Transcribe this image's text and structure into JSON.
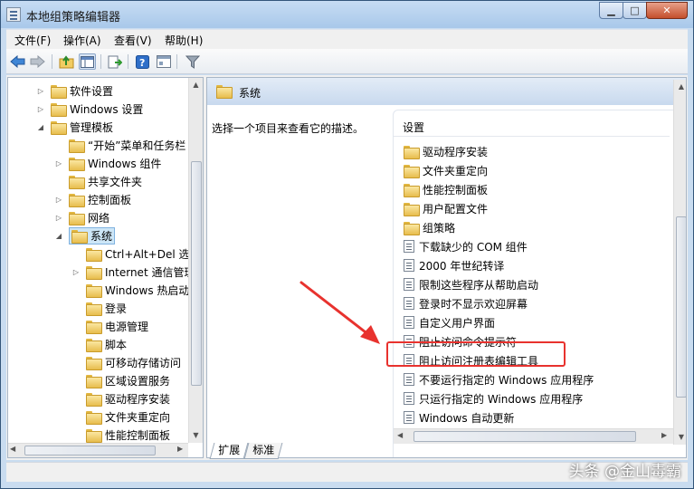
{
  "window": {
    "title": "本地组策略编辑器"
  },
  "menu": [
    "文件(F)",
    "操作(A)",
    "查看(V)",
    "帮助(H)"
  ],
  "tree": [
    {
      "label": "软件设置",
      "level": 1,
      "toggle": "▷",
      "folder": true
    },
    {
      "label": "Windows 设置",
      "level": 1,
      "toggle": "▷",
      "folder": true
    },
    {
      "label": "管理模板",
      "level": 1,
      "toggle": "◢",
      "folder": true
    },
    {
      "label": "“开始”菜单和任务栏",
      "level": 2,
      "toggle": "",
      "folder": true
    },
    {
      "label": "Windows 组件",
      "level": 2,
      "toggle": "▷",
      "folder": true
    },
    {
      "label": "共享文件夹",
      "level": 2,
      "toggle": "",
      "folder": true
    },
    {
      "label": "控制面板",
      "level": 2,
      "toggle": "▷",
      "folder": true
    },
    {
      "label": "网络",
      "level": 2,
      "toggle": "▷",
      "folder": true
    },
    {
      "label": "系统",
      "level": 2,
      "toggle": "◢",
      "folder": true,
      "selected": true
    },
    {
      "label": "Ctrl+Alt+Del 选项",
      "level": 3,
      "toggle": "",
      "folder": true
    },
    {
      "label": "Internet 通信管理",
      "level": 3,
      "toggle": "▷",
      "folder": true
    },
    {
      "label": "Windows 热启动",
      "level": 3,
      "toggle": "",
      "folder": true
    },
    {
      "label": "登录",
      "level": 3,
      "toggle": "",
      "folder": true
    },
    {
      "label": "电源管理",
      "level": 3,
      "toggle": "",
      "folder": true
    },
    {
      "label": "脚本",
      "level": 3,
      "toggle": "",
      "folder": true
    },
    {
      "label": "可移动存储访问",
      "level": 3,
      "toggle": "",
      "folder": true
    },
    {
      "label": "区域设置服务",
      "level": 3,
      "toggle": "",
      "folder": true
    },
    {
      "label": "驱动程序安装",
      "level": 3,
      "toggle": "",
      "folder": true
    },
    {
      "label": "文件夹重定向",
      "level": 3,
      "toggle": "",
      "folder": true
    },
    {
      "label": "性能控制面板",
      "level": 3,
      "toggle": "",
      "folder": true
    }
  ],
  "right": {
    "header_title": "系统",
    "description": "选择一个项目来查看它的描述。",
    "column_header": "设置",
    "items": [
      {
        "label": "驱动程序安装",
        "kind": "folder"
      },
      {
        "label": "文件夹重定向",
        "kind": "folder"
      },
      {
        "label": "性能控制面板",
        "kind": "folder"
      },
      {
        "label": "用户配置文件",
        "kind": "folder"
      },
      {
        "label": "组策略",
        "kind": "folder"
      },
      {
        "label": "下载缺少的 COM 组件",
        "kind": "policy"
      },
      {
        "label": "2000 年世纪转译",
        "kind": "policy"
      },
      {
        "label": "限制这些程序从帮助启动",
        "kind": "policy"
      },
      {
        "label": "登录时不显示欢迎屏幕",
        "kind": "policy"
      },
      {
        "label": "自定义用户界面",
        "kind": "policy"
      },
      {
        "label": "阻止访问命令提示符",
        "kind": "policy"
      },
      {
        "label": "阻止访问注册表编辑工具",
        "kind": "policy",
        "highlighted": true
      },
      {
        "label": "不要运行指定的 Windows 应用程序",
        "kind": "policy"
      },
      {
        "label": "只运行指定的 Windows 应用程序",
        "kind": "policy"
      },
      {
        "label": "Windows 自动更新",
        "kind": "policy"
      }
    ]
  },
  "tabs": [
    "扩展",
    "标准"
  ],
  "watermark": "头条 @金山毒霸",
  "colors": {
    "highlight": "#e8322e",
    "selection": "#cde6f7"
  }
}
